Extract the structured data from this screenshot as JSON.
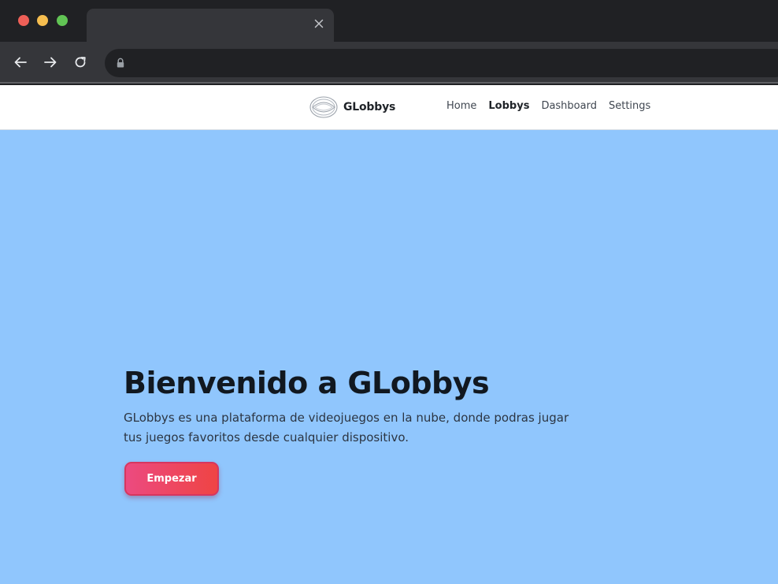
{
  "browser": {
    "tab_title": "",
    "tab_close_icon": "close-icon",
    "address": "",
    "icons": [
      "back-arrow-icon",
      "forward-arrow-icon",
      "reload-icon",
      "lock-icon"
    ]
  },
  "navbar": {
    "brand_name": "GLobbys",
    "brand_icon": "globbys-logo-icon",
    "links": [
      {
        "label": "Home",
        "active": false
      },
      {
        "label": "Lobbys",
        "active": true
      },
      {
        "label": "Dashboard",
        "active": false
      },
      {
        "label": "Settings",
        "active": false
      }
    ]
  },
  "hero": {
    "title": "Bienvenido a GLobbys",
    "description": "GLobbys es una plataforma de videojuegos en la nube, donde podras jugar tus juegos favoritos desde cualquier dispositivo.",
    "cta_label": "Empezar"
  },
  "colors": {
    "page_background": "#90c6fd",
    "cta_gradient_start": "#ec4a80",
    "cta_gradient_end": "#ef4444",
    "chrome_dark": "#202124",
    "chrome_toolbar": "#35363a"
  }
}
